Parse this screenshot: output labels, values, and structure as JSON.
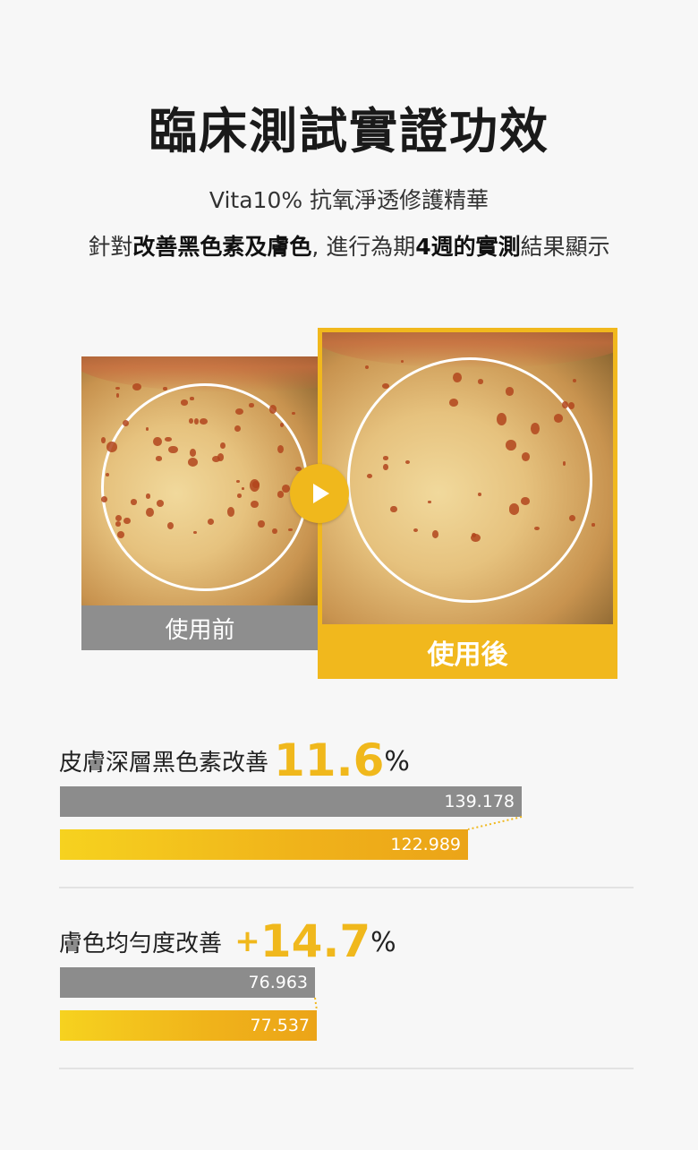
{
  "title": "臨床測試實證功效",
  "subtitle": "Vita10% 抗氧淨透修護精華",
  "description": {
    "prefix": "針對",
    "highlight1": "改善黑色素及膚色",
    "middle": ", 進行為期",
    "highlight2": "4週的實測",
    "suffix": "結果顯示"
  },
  "comparison": {
    "before_label": "使用前",
    "after_label": "使用後",
    "play_icon": "play-icon"
  },
  "stats": [
    {
      "label": "皮膚深層黑色素改善",
      "prefix": "",
      "value": "11.6",
      "unit": "%",
      "before": "139.178",
      "after": "122.989",
      "before_num": 139.178,
      "after_num": 122.989
    },
    {
      "label": "膚色均勻度改善",
      "prefix": "+",
      "value": "14.7",
      "unit": "%",
      "before": "76.963",
      "after": "77.537",
      "before_num": 76.963,
      "after_num": 77.537
    }
  ],
  "colors": {
    "accent": "#f0b81c",
    "grey_bar": "#8c8c8c",
    "label_before_bg": "#8e8e8e"
  }
}
